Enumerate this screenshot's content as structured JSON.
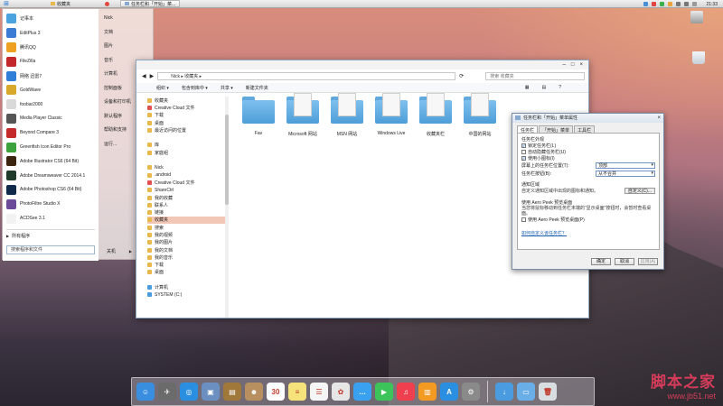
{
  "topbar": {
    "tasks": [
      {
        "label": "收藏夹"
      },
      {
        "label": "任务栏和「开始」菜..."
      }
    ],
    "clock": "21:33"
  },
  "start_menu": {
    "programs": [
      {
        "label": "记事本",
        "color": "#4aa3df"
      },
      {
        "label": "EditPlus 3",
        "color": "#3b7bd6"
      },
      {
        "label": "腾讯QQ",
        "color": "#f0a020"
      },
      {
        "label": "FileZilla",
        "color": "#c3262b"
      },
      {
        "label": "网络 迅雷7",
        "color": "#2f7fd8"
      },
      {
        "label": "GoldWave",
        "color": "#d8a82a"
      },
      {
        "label": "foobar2000",
        "color": "#d9d9d9"
      },
      {
        "label": "Media Player Classic",
        "color": "#555555"
      },
      {
        "label": "Beyond Compare 3",
        "color": "#c52a2a"
      },
      {
        "label": "Greenfish Icon Editor Pro",
        "color": "#3ca33c"
      },
      {
        "label": "Adobe Illustrator CS6 (64 Bit)",
        "color": "#3b2410"
      },
      {
        "label": "Adobe Dreamweaver CC 2014.1",
        "color": "#1f3a2a"
      },
      {
        "label": "Adobe Photoshop CS6 (64 Bit)",
        "color": "#0f2a4a"
      },
      {
        "label": "PhotoFiltre Studio X",
        "color": "#6b4a9a"
      },
      {
        "label": "ACDSee 3.1",
        "color": "#f2f2f2"
      }
    ],
    "all_programs": "所有程序",
    "search_placeholder": "搜索程序和文件",
    "right_items": [
      "Nick",
      "文档",
      "图片",
      "音乐",
      "计算机",
      "控制面板",
      "设备和打印机",
      "默认程序",
      "帮助和支持",
      "运行..."
    ],
    "shutdown": "关机"
  },
  "explorer": {
    "address": "Nick ▸ 收藏夹 ▸",
    "search_placeholder": "搜索 收藏夹",
    "toolbar": [
      "组织 ▾",
      "包含到库中 ▾",
      "共享 ▾",
      "新建文件夹"
    ],
    "nav": [
      {
        "label": "收藏夹",
        "icon": "star"
      },
      {
        "label": "Creative Cloud 文件",
        "icon": "cloud"
      },
      {
        "label": "下载",
        "icon": "folder"
      },
      {
        "label": "桌面",
        "icon": "folder"
      },
      {
        "label": "最近访问的位置",
        "icon": "folder"
      },
      {
        "label": "",
        "icon": "none"
      },
      {
        "label": "库",
        "icon": "folder"
      },
      {
        "label": "家庭组",
        "icon": "folder"
      },
      {
        "label": "",
        "icon": "none"
      },
      {
        "label": "Nick",
        "icon": "folder"
      },
      {
        "label": ".android",
        "icon": "folder"
      },
      {
        "label": "Creative Cloud 文件",
        "icon": "cloud"
      },
      {
        "label": "ShareCtrl",
        "icon": "folder"
      },
      {
        "label": "我的收藏",
        "icon": "folder"
      },
      {
        "label": "联系人",
        "icon": "folder"
      },
      {
        "label": "链接",
        "icon": "folder"
      },
      {
        "label": "收藏夹",
        "icon": "folder",
        "selected": true
      },
      {
        "label": "搜索",
        "icon": "folder"
      },
      {
        "label": "我的视频",
        "icon": "folder"
      },
      {
        "label": "我的图片",
        "icon": "folder"
      },
      {
        "label": "我的文档",
        "icon": "folder"
      },
      {
        "label": "我的音乐",
        "icon": "folder"
      },
      {
        "label": "下载",
        "icon": "folder"
      },
      {
        "label": "桌面",
        "icon": "folder"
      },
      {
        "label": "",
        "icon": "none"
      },
      {
        "label": "计算机",
        "icon": "computer"
      },
      {
        "label": "SYSTEM (C:)",
        "icon": "drive"
      }
    ],
    "files": [
      {
        "label": "Fav",
        "kind": "plain"
      },
      {
        "label": "Microsoft 网站",
        "kind": "doc"
      },
      {
        "label": "MSN 网站",
        "kind": "doc"
      },
      {
        "label": "Windows Live",
        "kind": "doc"
      },
      {
        "label": "收藏夹栏",
        "kind": "doc"
      },
      {
        "label": "中国的网站",
        "kind": "doc"
      }
    ]
  },
  "dialog": {
    "title": "任务栏和「开始」菜单属性",
    "tabs": [
      "任务栏",
      "「开始」菜单",
      "工具栏"
    ],
    "section_appearance": "任务栏外观",
    "checks": [
      {
        "label": "锁定任务栏(L)",
        "checked": true
      },
      {
        "label": "自动隐藏任务栏(U)",
        "checked": false
      },
      {
        "label": "使用小图标(I)",
        "checked": true
      }
    ],
    "position_label": "屏幕上的任务栏位置(T):",
    "position_value": "顶部",
    "buttons_label": "任务栏按钮(B):",
    "buttons_value": "从不合并",
    "section_notify": "通知区域",
    "notify_desc": "自定义通知区域中出现的图标和通知。",
    "customize_btn": "自定义(C)...",
    "section_peek": "使用 Aero Peek 预览桌面",
    "peek_desc": "当您将鼠标移动到任务栏末端的“显示桌面”按钮时，会暂时查看桌面。",
    "peek_check": "使用 Aero Peek 预览桌面(P)",
    "help_link": "如何自定义该任务栏？",
    "ok": "确定",
    "cancel": "取消",
    "apply": "应用(A)"
  },
  "desktop": {
    "icons": [
      "计算机",
      "回收站"
    ]
  },
  "dock": {
    "apps": [
      {
        "name": "finder",
        "color": "#3a8ee0",
        "glyph": "☺"
      },
      {
        "name": "launchpad",
        "color": "#6b6b6b",
        "glyph": "✈"
      },
      {
        "name": "safari",
        "color": "#2a8fe0",
        "glyph": "◎"
      },
      {
        "name": "preview",
        "color": "#6a8fc0",
        "glyph": "▣"
      },
      {
        "name": "notebook",
        "color": "#a0783a",
        "glyph": "▤"
      },
      {
        "name": "contacts",
        "color": "#b89060",
        "glyph": "☻"
      },
      {
        "name": "calendar",
        "color": "#ffffff",
        "glyph": "30"
      },
      {
        "name": "notes",
        "color": "#f5e27a",
        "glyph": "≡"
      },
      {
        "name": "reminders",
        "color": "#f5f5f5",
        "glyph": "☰"
      },
      {
        "name": "photos",
        "color": "#e6e6e6",
        "glyph": "✿"
      },
      {
        "name": "messages",
        "color": "#3aa0f0",
        "glyph": "…"
      },
      {
        "name": "facetime",
        "color": "#3cc45a",
        "glyph": "▶"
      },
      {
        "name": "music",
        "color": "#f04050",
        "glyph": "♫"
      },
      {
        "name": "books",
        "color": "#f29a22",
        "glyph": "▥"
      },
      {
        "name": "appstore",
        "color": "#2a8fe0",
        "glyph": "A"
      },
      {
        "name": "settings",
        "color": "#8a8a8a",
        "glyph": "⚙"
      },
      {
        "name": "downloads",
        "color": "#4a9be0",
        "glyph": "↓"
      },
      {
        "name": "documents",
        "color": "#6aaee8",
        "glyph": "▭"
      },
      {
        "name": "trash",
        "color": "#d8dde2",
        "glyph": "🗑"
      }
    ]
  },
  "watermark": {
    "line1": "脚本之家",
    "line2": "www.jb51.net"
  }
}
